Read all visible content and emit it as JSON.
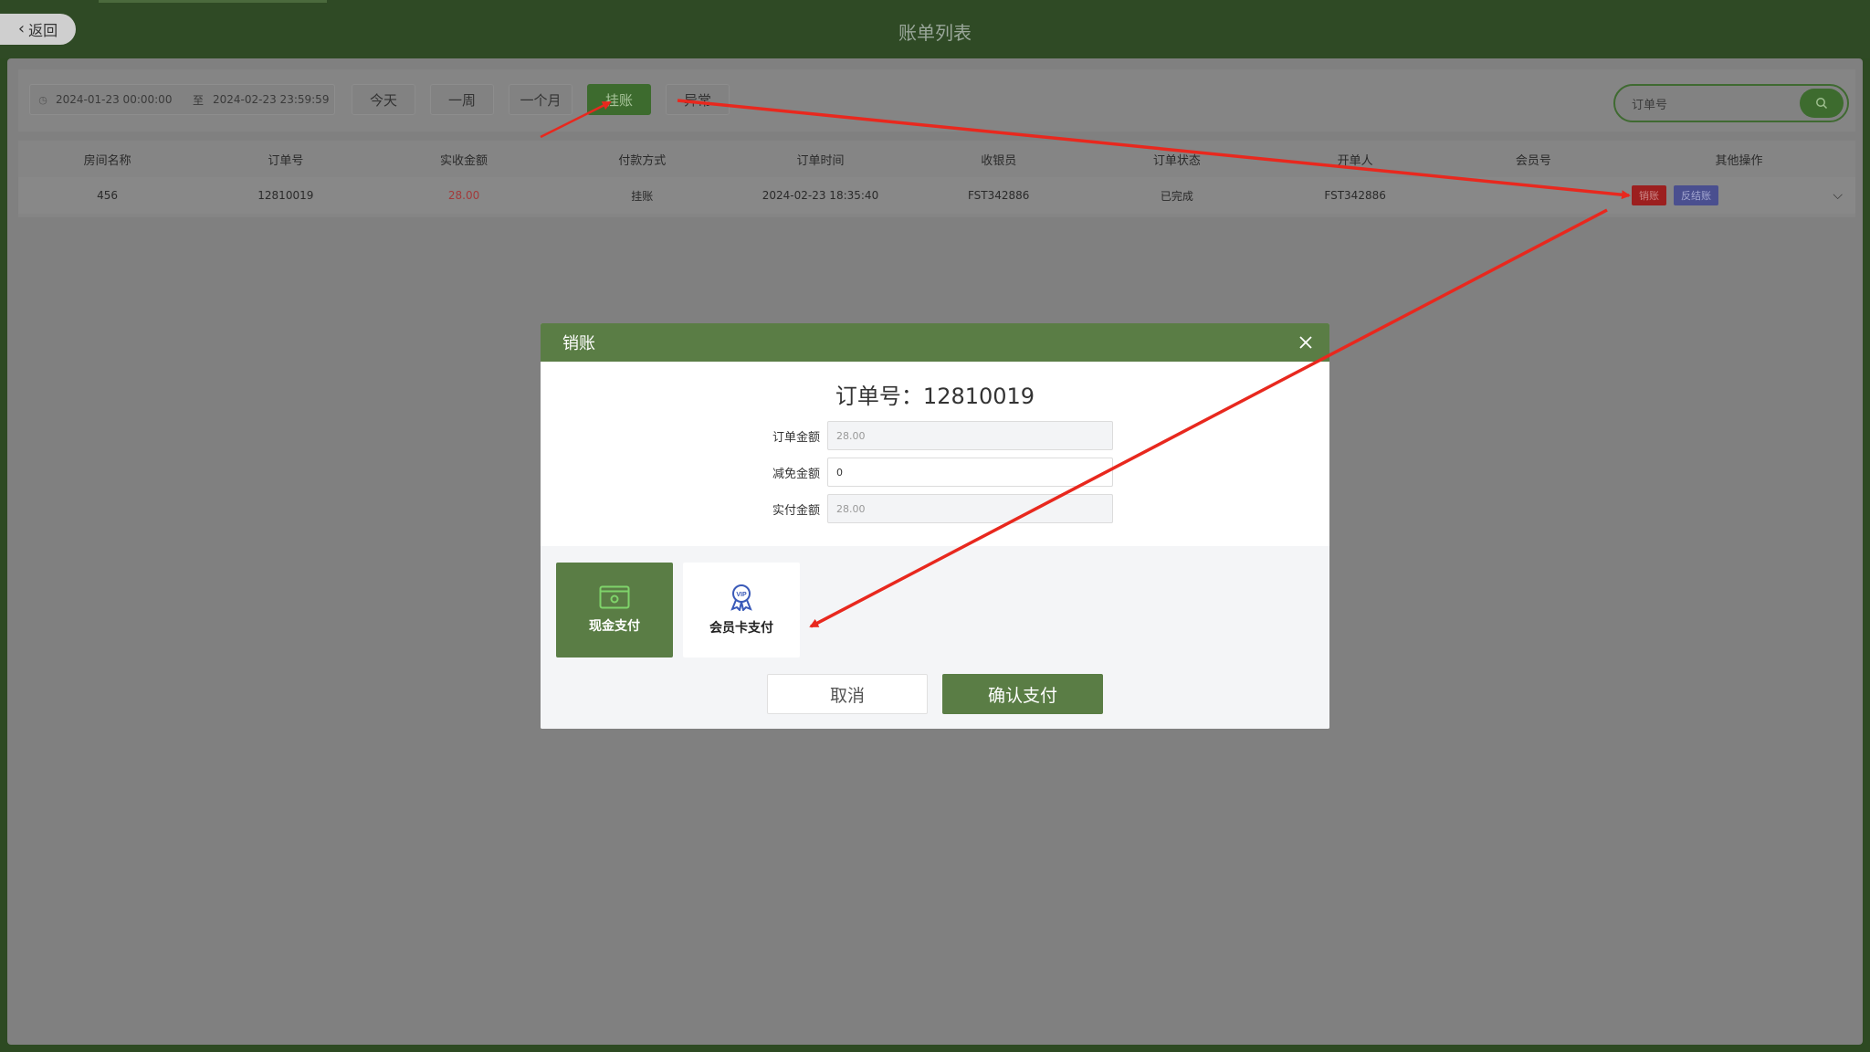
{
  "header": {
    "back_label": "返回",
    "title": "账单列表"
  },
  "filters": {
    "date_start": "2024-01-23 00:00:00",
    "date_sep": "至",
    "date_end": "2024-02-23 23:59:59",
    "quick": [
      {
        "label": "今天",
        "active": false
      },
      {
        "label": "一周",
        "active": false
      },
      {
        "label": "一个月",
        "active": false
      },
      {
        "label": "挂账",
        "active": true
      },
      {
        "label": "异常",
        "active": false
      }
    ],
    "search_placeholder": "订单号"
  },
  "table": {
    "headers": [
      "房间名称",
      "订单号",
      "实收金额",
      "付款方式",
      "订单时间",
      "收银员",
      "订单状态",
      "开单人",
      "会员号",
      "其他操作"
    ],
    "rows": [
      {
        "room": "456",
        "order_no": "12810019",
        "amount": "28.00",
        "pay_method": "挂账",
        "time": "2024-02-23 18:35:40",
        "cashier": "FST342886",
        "status": "已完成",
        "opener": "FST342886",
        "member_no": "",
        "op_writeoff": "销账",
        "op_reverse": "反结账"
      }
    ]
  },
  "modal": {
    "title": "销账",
    "order_heading": "订单号：12810019",
    "fields": {
      "order_amount_label": "订单金额",
      "order_amount_value": "28.00",
      "discount_label": "减免金额",
      "discount_value": "0",
      "paid_label": "实付金额",
      "paid_value": "28.00"
    },
    "pay_methods": {
      "cash": "现金支付",
      "member": "会员卡支付"
    },
    "cancel_label": "取消",
    "confirm_label": "确认支付"
  },
  "colors": {
    "brand_green": "#5a7d45",
    "annotation_red": "#e8281e"
  },
  "icons": {
    "back": "chevron-left-icon",
    "clock": "clock-icon",
    "search": "search-icon",
    "close": "close-icon",
    "cash": "cash-icon",
    "member": "vip-badge-icon",
    "expand": "chevron-down-icon"
  }
}
